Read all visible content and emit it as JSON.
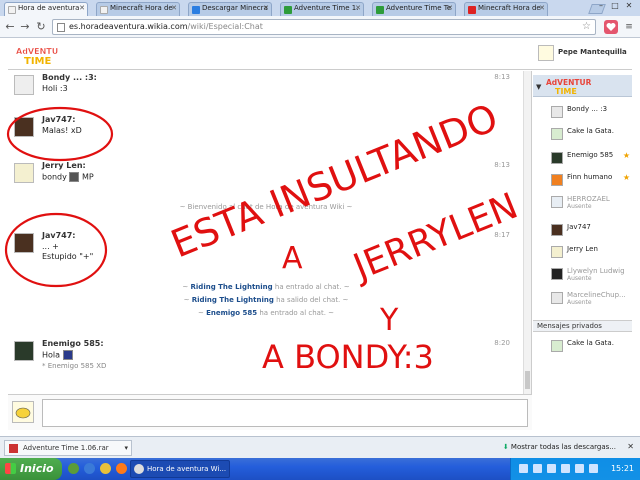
{
  "browser": {
    "tabs": [
      {
        "label": "Hora de aventura",
        "fav_color": "#f2f2f2",
        "active": true
      },
      {
        "label": "Minecraft Hora de",
        "fav_color": "#f2f2f2",
        "active": false
      },
      {
        "label": "Descargar Minecra",
        "fav_color": "#2a7de1",
        "active": false
      },
      {
        "label": "Adventure Time 1.",
        "fav_color": "#2e9c3a",
        "active": false
      },
      {
        "label": "Adventure Time Te",
        "fav_color": "#2e9c3a",
        "active": false
      },
      {
        "label": "Minecraft Hora de",
        "fav_color": "#d22",
        "active": false
      }
    ],
    "url_host": "es.horadeaventura.wikia.com",
    "url_path": "/wiki/Especial:Chat"
  },
  "chat": {
    "self_user": "Pepe Mantequilla",
    "messages": [
      {
        "user": "Bondy ... :3:",
        "lines": [
          "Holi :3"
        ],
        "time": "8:13"
      },
      {
        "user": "Jav747:",
        "lines": [
          "Malas! xD"
        ],
        "time": ""
      },
      {
        "user": "Jerry Len:",
        "lines": [
          "bondy",
          "MP"
        ],
        "time": "8:13"
      },
      {
        "user": "Jav747:",
        "lines": [
          "... +",
          "Estupido \"+\""
        ],
        "time": "8:17"
      },
      {
        "user": "Enemigo 585:",
        "lines": [
          "Hola",
          "* Enemigo 585 XD"
        ],
        "time": "8:20"
      }
    ],
    "welcome": "~ Bienvenido al chat de Hora de aventura Wiki ~",
    "events": [
      {
        "name": "Riding The Lightning",
        "text": "ha entrado al chat."
      },
      {
        "name": "Riding The Lightning",
        "text": "ha salido del chat."
      },
      {
        "name": "Enemigo 585",
        "text": "ha entrado al chat."
      }
    ]
  },
  "sidebar": {
    "users": [
      {
        "name": "Bondy ... :3",
        "status": "",
        "away": false,
        "star": false,
        "color": "#e8e8e8"
      },
      {
        "name": "Cake la Gata.",
        "status": "",
        "away": false,
        "star": false,
        "color": "#d8ecd0"
      },
      {
        "name": "Enemigo 585",
        "status": "",
        "away": false,
        "star": true,
        "color": "#2a3a2a"
      },
      {
        "name": "Finn humano",
        "status": "",
        "away": false,
        "star": true,
        "color": "#f08020"
      },
      {
        "name": "HERROZAEL",
        "status": "Ausente",
        "away": true,
        "star": false,
        "color": "#e8eef4"
      },
      {
        "name": "Jav747",
        "status": "",
        "away": false,
        "star": false,
        "color": "#4a3020"
      },
      {
        "name": "Jerry Len",
        "status": "",
        "away": false,
        "star": false,
        "color": "#f4f0d0"
      },
      {
        "name": "Llywelyn Ludwig",
        "status": "Ausente",
        "away": true,
        "star": false,
        "color": "#222222"
      },
      {
        "name": "MarcelineChup...",
        "status": "Ausente",
        "away": true,
        "star": false,
        "color": "#e8e8e8"
      }
    ],
    "private_header": "Mensajes privados",
    "private_users": [
      {
        "name": "Cake la Gata.",
        "color": "#d8ecd0"
      }
    ]
  },
  "downloads": {
    "file": "Adventure Time 1.06.rar",
    "show_all": "Mostrar todas las descargas..."
  },
  "taskbar": {
    "start": "Inicio",
    "task": "Hora de aventura Wi...",
    "clock": "15:21"
  },
  "annotation": {
    "lines": [
      "ESTA INSULTANDO",
      "A",
      "JERRYLEN",
      "Y",
      "A BONDY:3"
    ]
  }
}
